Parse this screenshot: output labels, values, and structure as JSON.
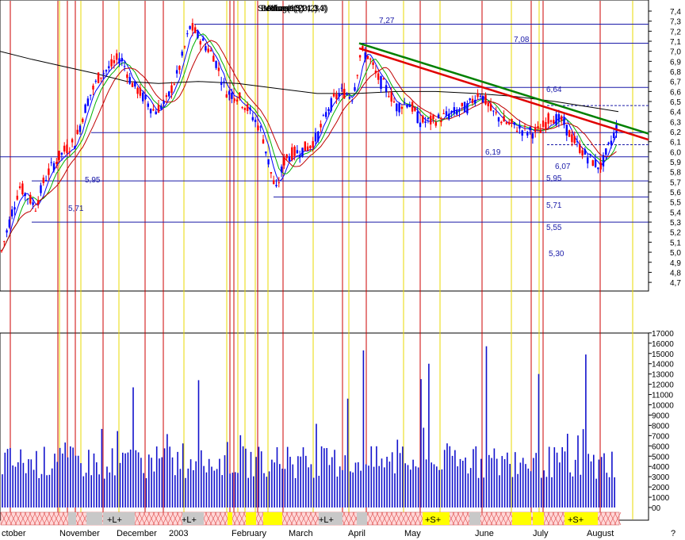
{
  "title": {
    "overlap_texts": [
      "Stochastic(14,3,3)",
      "Bollinger(20,2)",
      "Volume(5)",
      "Price(13,21,34)"
    ]
  },
  "price_axis": {
    "ticks": [
      "7,4",
      "7,3",
      "7,2",
      "7,1",
      "7,0",
      "6,9",
      "6,8",
      "6,7",
      "6,6",
      "6,5",
      "6,4",
      "6,3",
      "6,2",
      "6,1",
      "6,0",
      "5,9",
      "5,8",
      "5,7",
      "5,6",
      "5,5",
      "5,4",
      "5,3",
      "5,2",
      "5,1",
      "5,0",
      "4,9",
      "4,8",
      "4,7"
    ]
  },
  "volume_axis": {
    "ticks": [
      "17000",
      "16000",
      "15000",
      "14000",
      "13000",
      "12000",
      "11000",
      "10000",
      "9000",
      "8000",
      "7000",
      "6000",
      "5000",
      "4000",
      "3000",
      "2000",
      "1000",
      "00"
    ]
  },
  "months": [
    "ctober",
    "November",
    "December",
    "2003",
    "February",
    "March",
    "April",
    "May",
    "June",
    "July",
    "August"
  ],
  "level_labels": [
    "7,27",
    "7,08",
    "6,64",
    "6,19",
    "6,07",
    "5,95",
    "5,95",
    "5,71",
    "5,71",
    "5,55",
    "5,30"
  ],
  "band_labels": [
    "+L+",
    "+L+",
    "+L+",
    "+S+",
    "+S+"
  ],
  "colors": {
    "up": "#0000ff",
    "down": "#ff0000",
    "ma_fast": "#0000ff",
    "ma_mid": "#00b000",
    "ma_slow": "#c00000",
    "ma_long": "#000000",
    "trend_green": "#008000",
    "trend_red": "#e00000",
    "vline_red": "#cc0000",
    "vline_yellow": "#e8d800",
    "hline": "#1a1aa8"
  },
  "chart_data": {
    "type": "candlestick+volume",
    "series_approx_close": [
      {
        "month": "October",
        "close": 5.4
      },
      {
        "month": "November",
        "close": 6.05
      },
      {
        "month": "December",
        "close": 6.6
      },
      {
        "month": "January",
        "close": 7.25
      },
      {
        "month": "February",
        "close": 6.4
      },
      {
        "month": "March",
        "close": 5.95
      },
      {
        "month": "April",
        "close": 6.95
      },
      {
        "month": "May",
        "close": 6.35
      },
      {
        "month": "June",
        "close": 6.55
      },
      {
        "month": "July",
        "close": 6.3
      },
      {
        "month": "August",
        "close": 6.35
      }
    ],
    "ylim_price": [
      4.7,
      7.4
    ],
    "ylim_volume": [
      0,
      17000
    ],
    "levels": [
      7.27,
      7.08,
      6.64,
      6.19,
      6.07,
      5.95,
      5.71,
      5.55,
      5.3
    ]
  }
}
